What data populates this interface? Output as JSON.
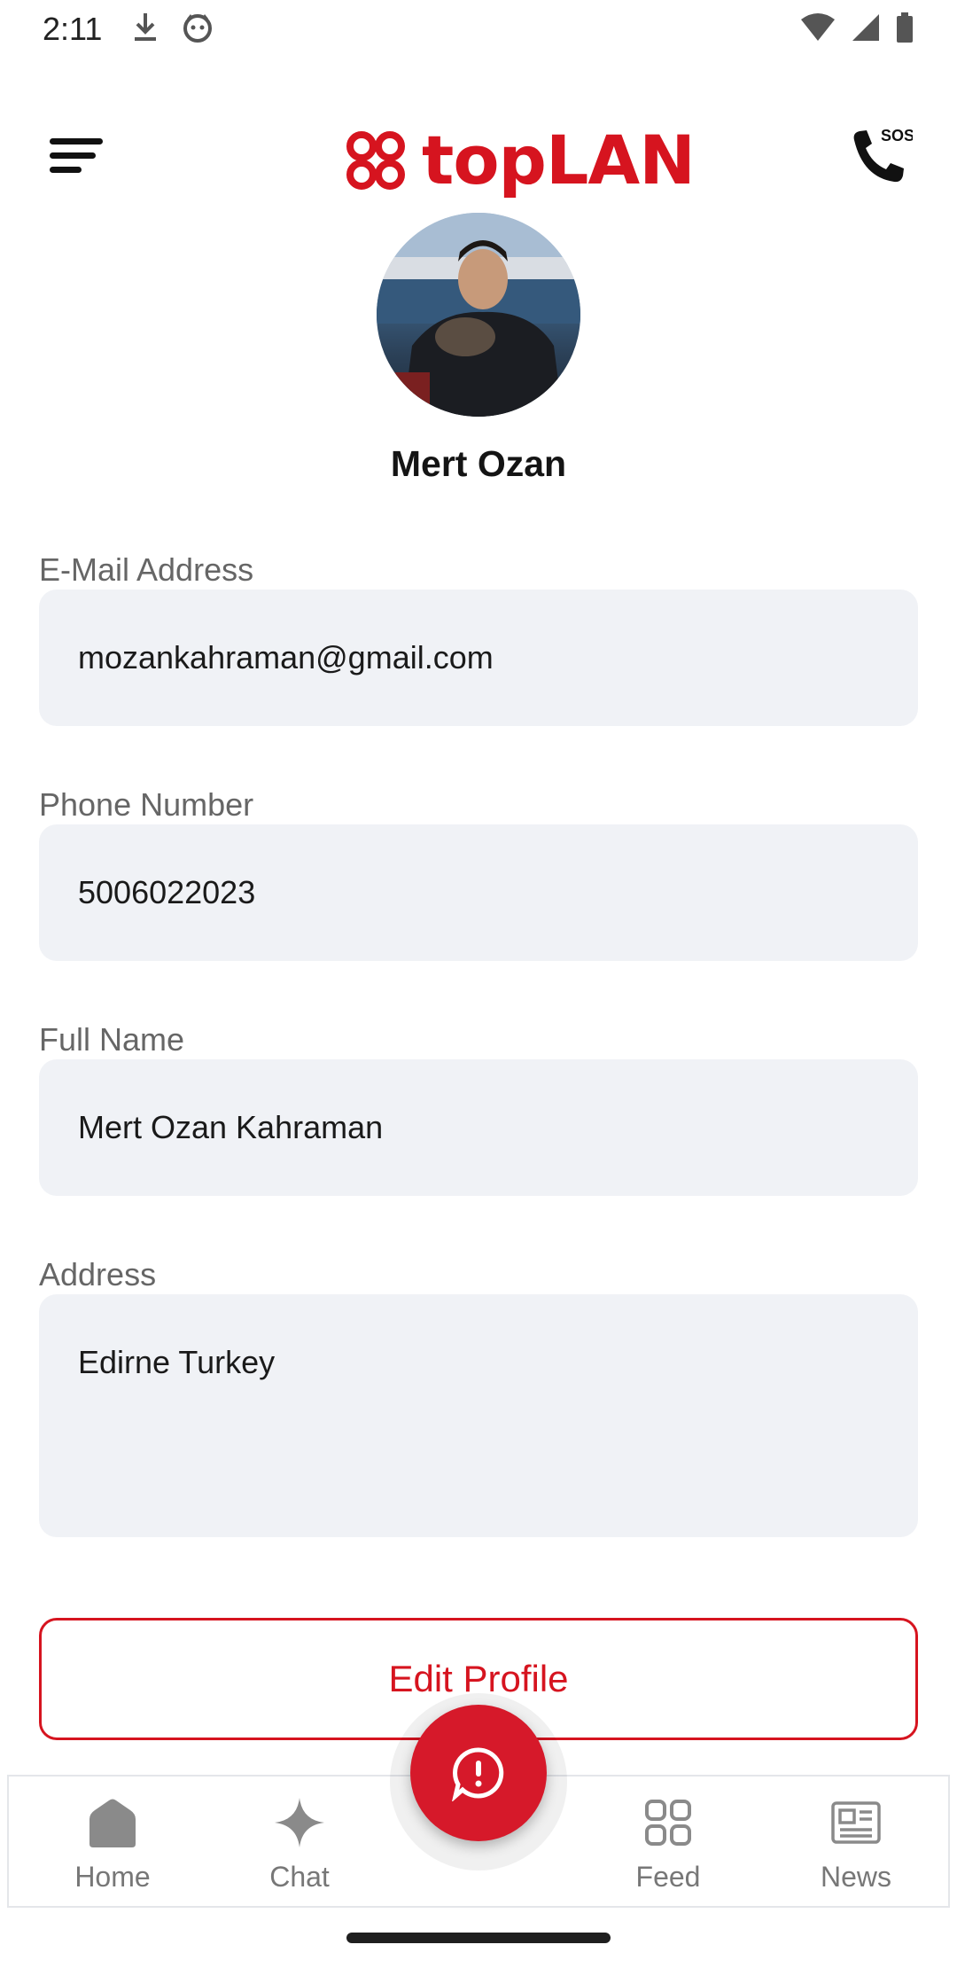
{
  "status_bar": {
    "time": "2:11",
    "left_icons": [
      "download-icon",
      "cat-icon"
    ],
    "right_icons": [
      "wifi-icon",
      "signal-icon",
      "battery-icon"
    ]
  },
  "header": {
    "logo_text": "topLAN",
    "brand_color": "#d6141f",
    "menu_icon": "menu-icon",
    "sos_label": "SOS"
  },
  "profile": {
    "name": "Mert Ozan",
    "fields": [
      {
        "label": "E-Mail Address",
        "value": "mozankahraman@gmail.com"
      },
      {
        "label": "Phone Number",
        "value": "5006022023"
      },
      {
        "label": "Full Name",
        "value": "Mert Ozan Kahraman"
      },
      {
        "label": "Address",
        "value": "Edirne Turkey"
      }
    ],
    "edit_button": "Edit Profile"
  },
  "bottom_nav": {
    "items": [
      {
        "label": "Home",
        "icon": "home-icon"
      },
      {
        "label": "Chat",
        "icon": "sparkle-icon"
      },
      {
        "label": "Feed",
        "icon": "grid-icon"
      },
      {
        "label": "News",
        "icon": "newspaper-icon"
      }
    ],
    "fab_icon": "alert-chat-icon"
  }
}
